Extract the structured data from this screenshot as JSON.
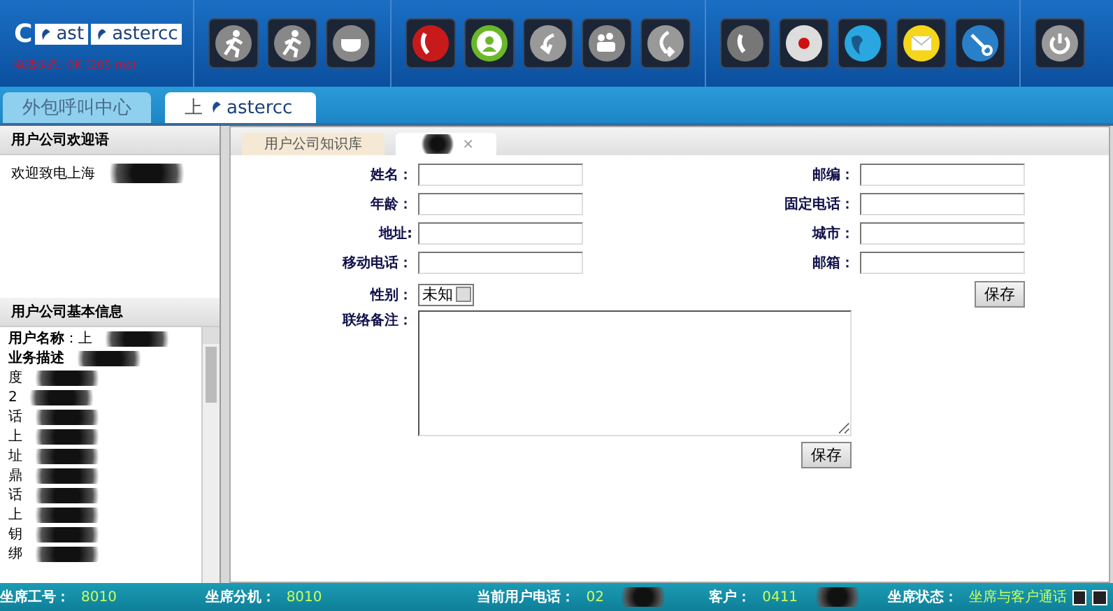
{
  "header": {
    "logo": [
      "C",
      "ast",
      "astercc"
    ],
    "phone_status": "电话状态: OK (205 ms)"
  },
  "toolbar": [
    [
      {
        "kind": "run"
      },
      {
        "kind": "run"
      },
      {
        "kind": "cup"
      }
    ],
    [
      {
        "kind": "hangup"
      },
      {
        "kind": "contact"
      },
      {
        "kind": "back"
      },
      {
        "kind": "group"
      },
      {
        "kind": "forward"
      }
    ],
    [
      {
        "kind": "phone"
      },
      {
        "kind": "record"
      },
      {
        "kind": "globe"
      },
      {
        "kind": "mail"
      },
      {
        "kind": "tools"
      }
    ],
    [
      {
        "kind": "power"
      }
    ]
  ],
  "tabs": [
    {
      "label": "外包呼叫中心",
      "selected": false
    },
    {
      "label": "上",
      "logo": "astercc",
      "selected": true
    }
  ],
  "sidebar": {
    "welcome": {
      "title": "用户公司欢迎语",
      "text": "欢迎致电上海"
    },
    "info": {
      "title": "用户公司基本信息",
      "lines": [
        "**用户名称**：上",
        "**业务描述**",
        "度",
        "2",
        "话",
        "上",
        "址",
        "鼎",
        "话",
        "上",
        "钥",
        "绑"
      ]
    }
  },
  "subtabs": [
    {
      "label": "用户公司知识库",
      "selected": false
    },
    {
      "close": "×",
      "selected": true
    }
  ],
  "form": {
    "fields": [
      {
        "label": "姓名：",
        "kind": "input"
      },
      {
        "label": "邮编：",
        "kind": "input"
      },
      {
        "label": "年龄：",
        "kind": "input"
      },
      {
        "label": "固定电话：",
        "kind": "input"
      },
      {
        "label": "地址:",
        "kind": "input"
      },
      {
        "label": "城市：",
        "kind": "input"
      },
      {
        "label": "移动电话：",
        "kind": "input"
      },
      {
        "label": "邮箱：",
        "kind": "input"
      }
    ],
    "gender": {
      "label": "性别：",
      "value": "未知"
    },
    "save": "保存",
    "notes": {
      "label": "联络备注："
    },
    "save2": "保存"
  },
  "status_bar": [
    {
      "label": "坐席工号：",
      "value": "8010"
    },
    {
      "label": "坐席分机：",
      "value": "8010"
    },
    {
      "label": "当前用户电话：",
      "value": "02"
    },
    {
      "label": "客户：",
      "value": "0411"
    },
    {
      "label": "坐席状态：",
      "value": "坐席与客户通话"
    }
  ]
}
